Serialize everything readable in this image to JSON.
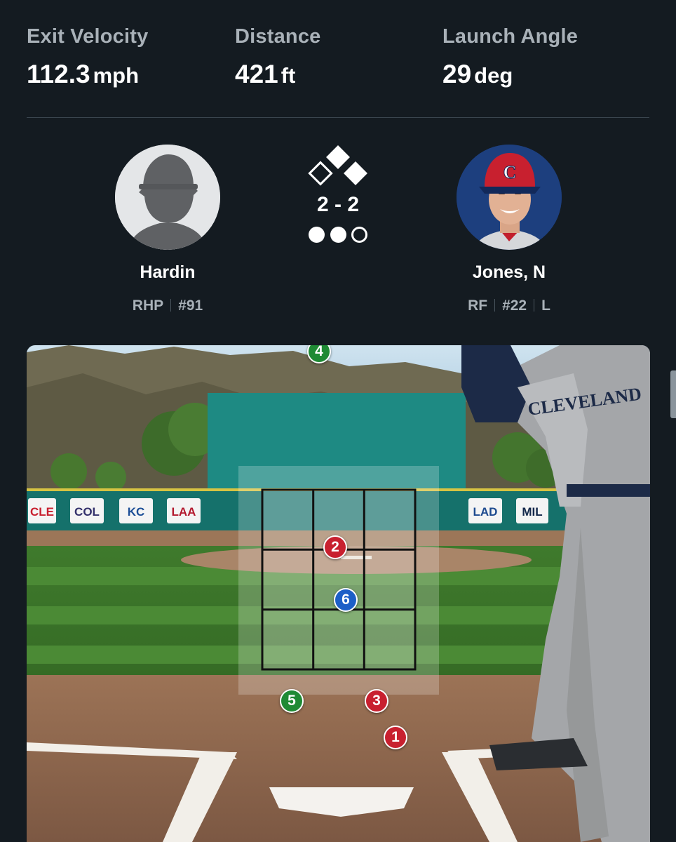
{
  "stats": [
    {
      "label": "Exit Velocity",
      "value": "112.3",
      "unit": "mph"
    },
    {
      "label": "Distance",
      "value": "421",
      "unit": "ft"
    },
    {
      "label": "Launch Angle",
      "value": "29",
      "unit": "deg"
    }
  ],
  "pitcher": {
    "name": "Hardin",
    "throws": "RHP",
    "number": "#91"
  },
  "batter": {
    "name": "Jones, N",
    "position": "RF",
    "number": "#22",
    "bats": "L"
  },
  "count": {
    "text": "2 - 2",
    "outs": 2,
    "bases": {
      "first": true,
      "second": true,
      "third": false
    }
  },
  "outfield_wall_signs": [
    "CLE",
    "COL",
    "KC",
    "LAA",
    "LAD",
    "MIL"
  ],
  "pitches": [
    {
      "num": "1",
      "result": "strike"
    },
    {
      "num": "2",
      "result": "strike"
    },
    {
      "num": "3",
      "result": "strike"
    },
    {
      "num": "4",
      "result": "ball"
    },
    {
      "num": "5",
      "result": "ball"
    },
    {
      "num": "6",
      "result": "in-play"
    }
  ],
  "colors": {
    "background": "#141b21",
    "ball": "#1f8a34",
    "strike": "#c8202f",
    "in_play": "#1d5fc7"
  }
}
